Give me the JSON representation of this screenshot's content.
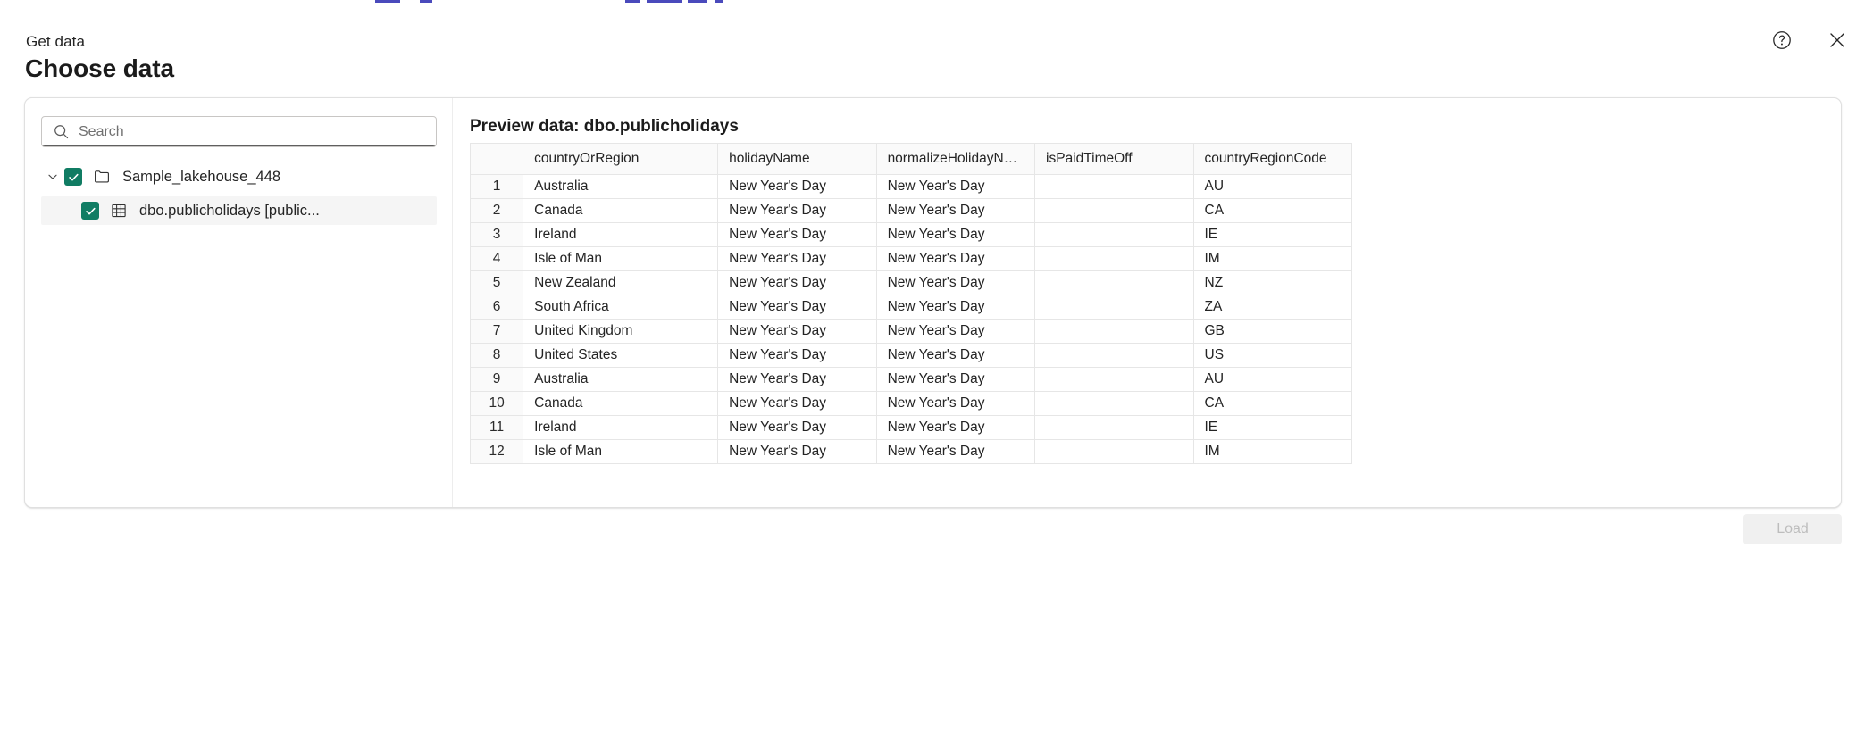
{
  "header": {
    "eyebrow": "Get data",
    "title": "Choose data",
    "help_icon": "help-circle-icon",
    "close_icon": "close-icon"
  },
  "search": {
    "placeholder": "Search",
    "value": "",
    "icon": "search-icon"
  },
  "tree": {
    "items": [
      {
        "label": "Sample_lakehouse_448",
        "icon": "folder-icon",
        "checked": true,
        "expanded": true,
        "level": 0,
        "chevron": "chevron-down-icon"
      },
      {
        "label": "dbo.publicholidays [public...",
        "icon": "table-grid-icon",
        "checked": true,
        "selected": true,
        "level": 1
      }
    ]
  },
  "preview": {
    "title": "Preview data: dbo.publicholidays",
    "rownum_header": "",
    "columns": [
      "countryOrRegion",
      "holidayName",
      "normalizeHolidayName",
      "isPaidTimeOff",
      "countryRegionCode"
    ],
    "rows": [
      {
        "n": "1",
        "countryOrRegion": "Australia",
        "holidayName": "New Year's Day",
        "normalizeHolidayName": "New Year's Day",
        "isPaidTimeOff": "",
        "countryRegionCode": "AU"
      },
      {
        "n": "2",
        "countryOrRegion": "Canada",
        "holidayName": "New Year's Day",
        "normalizeHolidayName": "New Year's Day",
        "isPaidTimeOff": "",
        "countryRegionCode": "CA"
      },
      {
        "n": "3",
        "countryOrRegion": "Ireland",
        "holidayName": "New Year's Day",
        "normalizeHolidayName": "New Year's Day",
        "isPaidTimeOff": "",
        "countryRegionCode": "IE"
      },
      {
        "n": "4",
        "countryOrRegion": "Isle of Man",
        "holidayName": "New Year's Day",
        "normalizeHolidayName": "New Year's Day",
        "isPaidTimeOff": "",
        "countryRegionCode": "IM"
      },
      {
        "n": "5",
        "countryOrRegion": "New Zealand",
        "holidayName": "New Year's Day",
        "normalizeHolidayName": "New Year's Day",
        "isPaidTimeOff": "",
        "countryRegionCode": "NZ"
      },
      {
        "n": "6",
        "countryOrRegion": "South Africa",
        "holidayName": "New Year's Day",
        "normalizeHolidayName": "New Year's Day",
        "isPaidTimeOff": "",
        "countryRegionCode": "ZA"
      },
      {
        "n": "7",
        "countryOrRegion": "United Kingdom",
        "holidayName": "New Year's Day",
        "normalizeHolidayName": "New Year's Day",
        "isPaidTimeOff": "",
        "countryRegionCode": "GB"
      },
      {
        "n": "8",
        "countryOrRegion": "United States",
        "holidayName": "New Year's Day",
        "normalizeHolidayName": "New Year's Day",
        "isPaidTimeOff": "",
        "countryRegionCode": "US"
      },
      {
        "n": "9",
        "countryOrRegion": "Australia",
        "holidayName": "New Year's Day",
        "normalizeHolidayName": "New Year's Day",
        "isPaidTimeOff": "",
        "countryRegionCode": "AU"
      },
      {
        "n": "10",
        "countryOrRegion": "Canada",
        "holidayName": "New Year's Day",
        "normalizeHolidayName": "New Year's Day",
        "isPaidTimeOff": "",
        "countryRegionCode": "CA"
      },
      {
        "n": "11",
        "countryOrRegion": "Ireland",
        "holidayName": "New Year's Day",
        "normalizeHolidayName": "New Year's Day",
        "isPaidTimeOff": "",
        "countryRegionCode": "IE"
      },
      {
        "n": "12",
        "countryOrRegion": "Isle of Man",
        "holidayName": "New Year's Day",
        "normalizeHolidayName": "New Year's Day",
        "isPaidTimeOff": "",
        "countryRegionCode": "IM"
      }
    ]
  },
  "footer": {
    "load_label": "Load",
    "load_disabled": true
  },
  "colors": {
    "checkbox_green": "#107c63",
    "panel_border": "#e0e0e0",
    "grid_line": "#e6e6e6",
    "header_fill": "#fafafa",
    "selected_row_fill": "#f5f5f5",
    "disabled_button_fill": "#f0f0f0",
    "disabled_button_text": "#bdbdbd",
    "text_primary": "#242424"
  }
}
